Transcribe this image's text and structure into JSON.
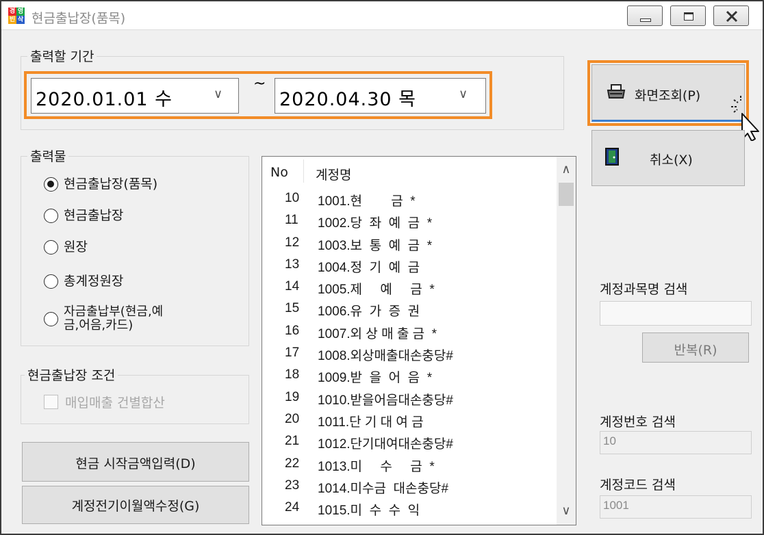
{
  "window": {
    "title": "현금출납장(품목)",
    "app_icon_glyphs": [
      "경",
      "영",
      "빈",
      "삭"
    ]
  },
  "period": {
    "group_label": "출력할 기간",
    "start_date": "2020.01.01 수",
    "end_date": "2020.04.30 목",
    "separator": "~",
    "dropdown_icon": "chevron-down-icon"
  },
  "output": {
    "group_label": "출력물",
    "options": [
      {
        "label": "현금출납장(품목)",
        "selected": true
      },
      {
        "label": "현금출납장",
        "selected": false
      },
      {
        "label": "원장",
        "selected": false
      },
      {
        "label": "총계정원장",
        "selected": false
      },
      {
        "label": "자금출납부(현금,예\n금,어음,카드)",
        "selected": false
      }
    ]
  },
  "cash_condition": {
    "group_label": "현금출납장 조건",
    "checkbox_label": "매입매출 건별합산",
    "checked": false
  },
  "buttons": {
    "cash_start_amount": "현금 시작금액입력(D)",
    "account_prior_balance": "계정전기이월액수정(G)",
    "view": "화면조회(P)",
    "cancel": "취소(X)",
    "repeat": "반복(R)"
  },
  "account_list": {
    "headers": {
      "no": "No",
      "name": "계정명"
    },
    "rows": [
      {
        "no": "10",
        "name": "1001.현        금  *"
      },
      {
        "no": "11",
        "name": "1002.당  좌  예  금  *"
      },
      {
        "no": "12",
        "name": "1003.보  통  예  금  *"
      },
      {
        "no": "13",
        "name": "1004.정  기  예  금"
      },
      {
        "no": "14",
        "name": "1005.제     예     금  *"
      },
      {
        "no": "15",
        "name": "1006.유  가  증  권"
      },
      {
        "no": "16",
        "name": "1007.외 상 매 출 금  *"
      },
      {
        "no": "17",
        "name": "1008.외상매출대손충당#"
      },
      {
        "no": "18",
        "name": "1009.받  을  어  음  *"
      },
      {
        "no": "19",
        "name": "1010.받을어음대손충당#"
      },
      {
        "no": "20",
        "name": "1011.단 기 대 여 금"
      },
      {
        "no": "21",
        "name": "1012.단기대여대손충당#"
      },
      {
        "no": "22",
        "name": "1013.미     수     금  *"
      },
      {
        "no": "23",
        "name": "1014.미수금  대손충당#"
      },
      {
        "no": "24",
        "name": "1015.미  수  수  익"
      }
    ]
  },
  "search": {
    "account_name_label": "계정과목명 검색",
    "account_name_value": "",
    "account_number_label": "계정번호 검색",
    "account_number_value": "10",
    "account_code_label": "계정코드 검색",
    "account_code_value": "1001"
  },
  "colors": {
    "highlight": "#f28c28",
    "window_bg": "#f0f0f0",
    "button_bg": "#e1e1e1"
  }
}
